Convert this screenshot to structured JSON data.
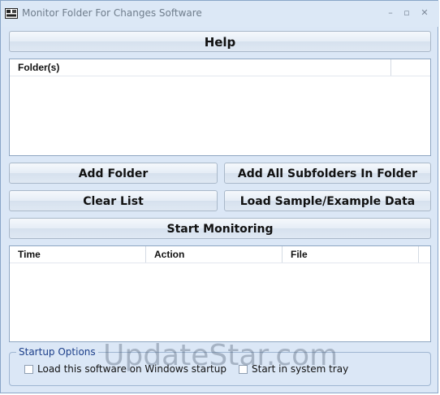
{
  "window": {
    "title": "Monitor Folder For Changes Software",
    "minimize_glyph": "–",
    "maximize_glyph": "▫",
    "close_glyph": "✕"
  },
  "buttons": {
    "help": "Help",
    "add_folder": "Add Folder",
    "add_all_subfolders": "Add All Subfolders In Folder",
    "clear_list": "Clear List",
    "load_sample": "Load Sample/Example Data",
    "start_monitoring": "Start Monitoring"
  },
  "folders_list": {
    "columns": [
      "Folder(s)"
    ]
  },
  "log_list": {
    "columns": [
      "Time",
      "Action",
      "File"
    ]
  },
  "startup_options": {
    "title": "Startup Options",
    "load_on_startup": {
      "label": "Load this software on Windows startup",
      "checked": false
    },
    "start_in_tray": {
      "label": "Start in system tray",
      "checked": false
    }
  },
  "watermark": "UpdateStar.com",
  "colors": {
    "window_bg": "#dbe7f6",
    "group_title": "#1c3f8a"
  },
  "icons": {
    "app": "app-icon",
    "minimize": "minimize-icon",
    "maximize": "maximize-icon",
    "close": "close-icon"
  }
}
